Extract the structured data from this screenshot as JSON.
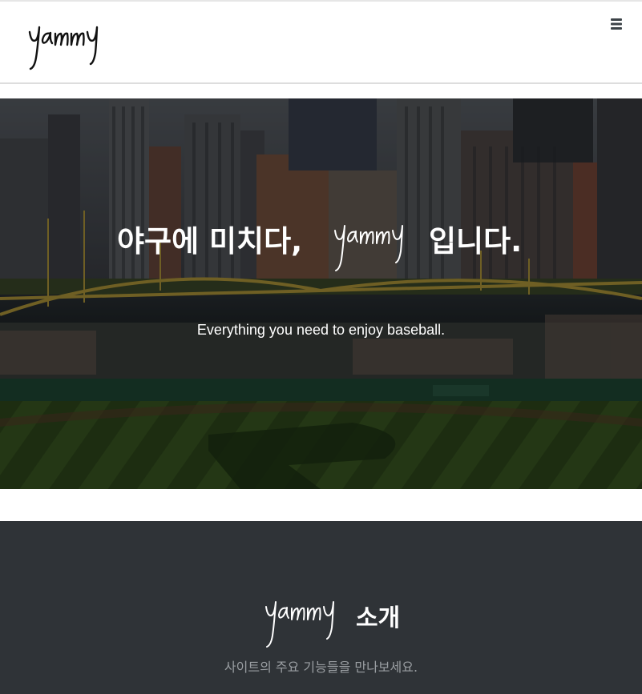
{
  "brand": {
    "logo_text": "yammy",
    "logo_icon": "script-logo"
  },
  "nav": {
    "menu_icon": "hamburger-menu-icon"
  },
  "hero": {
    "headline_before": "야구에 미치다,",
    "headline_after": "입니다.",
    "subtitle": "Everything you need to enjoy baseball.",
    "background": "baseball-stadium-photo"
  },
  "about": {
    "title_suffix": "소개",
    "subtitle": "사이트의 주요 기능들을 만나보세요."
  },
  "colors": {
    "navbar_bg": "#ffffff",
    "about_bg": "#2f3337",
    "logo_dark": "#111111",
    "text_light": "#ffffff",
    "subtitle_gray": "#9a9ea2"
  }
}
